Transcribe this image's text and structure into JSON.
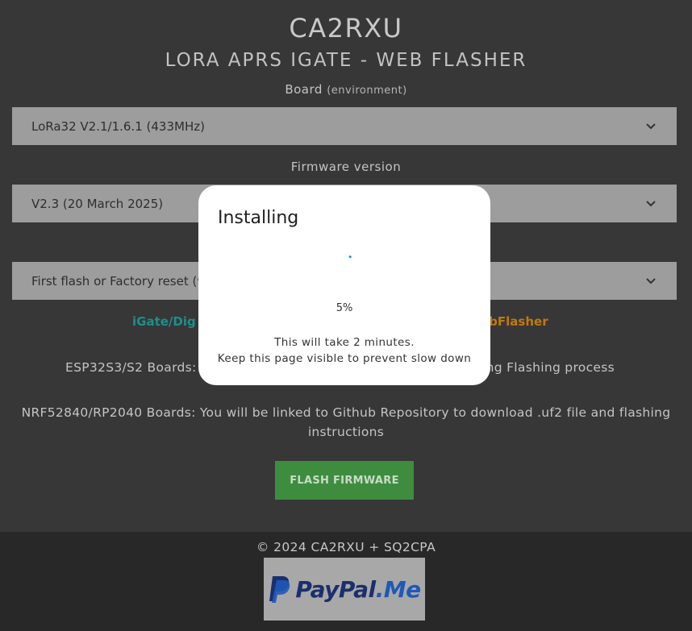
{
  "header": {
    "callsign": "CA2RXU",
    "subtitle": "LORA APRS IGATE - WEB FLASHER"
  },
  "board": {
    "label": "Board",
    "label_note": "(environment)",
    "selected": "LoRa32 V2.1/1.6.1 (433MHz)"
  },
  "firmware": {
    "label": "Firmware version",
    "selected": "V2.3 (20 March 2025)"
  },
  "flash_type": {
    "selected": "First flash or Factory reset (we"
  },
  "links": {
    "left": "iGate/Dig",
    "right": "ebFlasher"
  },
  "notes": {
    "esp32_left": "ESP32S3/S2 Boards:",
    "esp32_right": "ing Flashing process",
    "nrf": "NRF52840/RP2040 Boards: You will be linked to Github Repository to download .uf2 file and flashing instructions"
  },
  "flash_button": "FLASH FIRMWARE",
  "footer": {
    "copyright": "© 2024 CA2RXU + SQ2CPA",
    "paypal_part1": "PayPal",
    "paypal_part2": ".Me"
  },
  "modal": {
    "title": "Installing",
    "progress": 5,
    "progress_text": "5%",
    "message_line1": "This will take 2 minutes.",
    "message_line2": "Keep this page visible to prevent slow down"
  },
  "colors": {
    "accent_teal": "#1d8f8b",
    "accent_orange": "#c07a10",
    "button_green": "#3e8d3f",
    "spinner_blue": "#1a8fe0"
  }
}
